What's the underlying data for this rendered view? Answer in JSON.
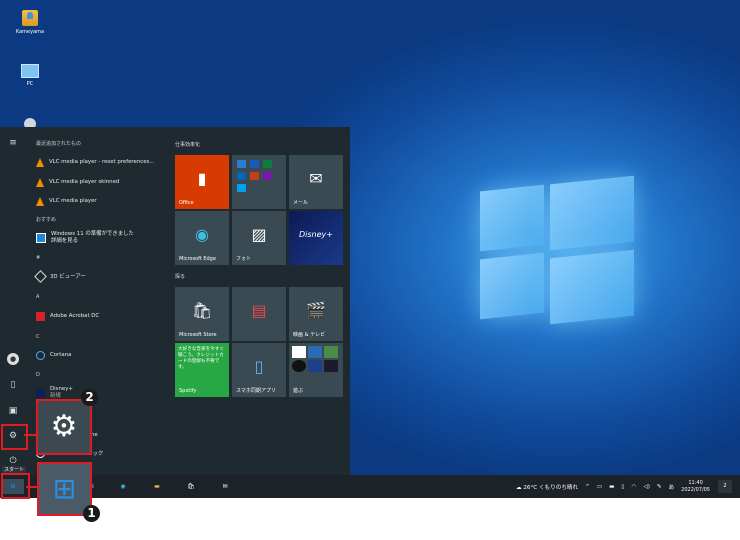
{
  "desktop": {
    "icons": [
      {
        "label": "Kameyama",
        "icon": "user-folder-icon"
      },
      {
        "label": "PC",
        "icon": "pc-icon"
      }
    ]
  },
  "start_menu": {
    "recently_added_header": "最近追加されたもの",
    "recent_apps": [
      "VLC media player - reset preferences...",
      "VLC media player skinned",
      "VLC media player"
    ],
    "recommended_header": "おすすめ",
    "recommended_item": [
      "Windows 11 の準備ができました",
      "詳細を見る"
    ],
    "sections": [
      "#",
      "A",
      "C",
      "D"
    ],
    "apps": [
      "3D ビューアー",
      "Adobe Acrobat DC",
      "Cortana",
      "Disney+",
      "Groove ミュージック"
    ],
    "apps_new_badge": "新規",
    "partial_app": "ne",
    "groups": {
      "productivity": "仕事効率化",
      "explore": "探る"
    },
    "tiles": {
      "office": "Office",
      "mail": "メール",
      "edge": "Microsoft Edge",
      "photos": "フォト",
      "store": "Microsoft Store",
      "movies": "映画 & テレビ",
      "spotify_promo": "大好きな音楽を今すぐ聴こう。クレジットカードの登録も不要です。",
      "spotify": "Spotify",
      "phone": "スマホ同期アプリ",
      "games": "遊ぶ",
      "disney": "Disney+"
    },
    "start_tooltip": "スタート"
  },
  "taskbar": {
    "weather": "26°C くもりのち晴れ",
    "ime": "あ",
    "time": "11:40",
    "date": "2022/07/05",
    "notification_count": "2"
  },
  "callouts": {
    "badge_1": "1",
    "badge_2": "2"
  },
  "colors": {
    "accent": "#e11b22",
    "office": "#d83b01",
    "spotify": "#27a844",
    "tile": "#3a4a52",
    "menu_bg": "#1f2a30"
  }
}
